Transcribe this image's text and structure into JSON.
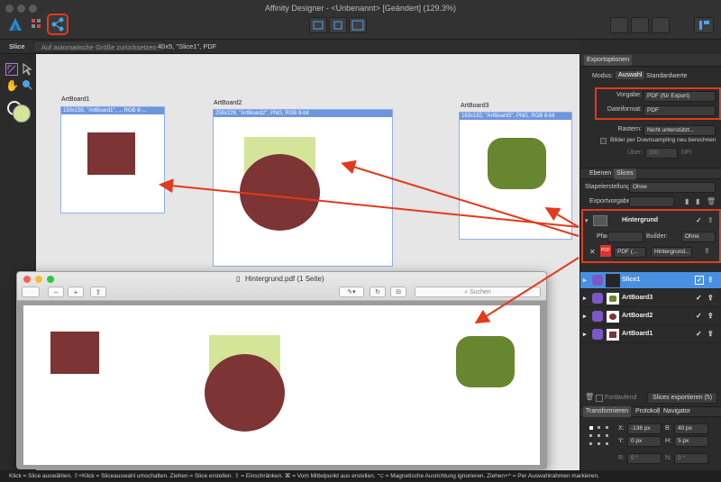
{
  "window": {
    "title": "Affinity Designer - <Unbenannt> [Geändert] (129.3%)"
  },
  "context": {
    "tool": "Slice",
    "reset_label": "Auf automatische Größe zurücksetzen",
    "info": "40x5, \"Slice1\", PDF"
  },
  "artboards": [
    {
      "label": "ArtBoard1",
      "header": "150x155, \"ArtBoard1\", ... RGB 8-..."
    },
    {
      "label": "ArtBoard2",
      "header": "258x226, \"ArtBoard2\", PNG, RGB 8-bit"
    },
    {
      "label": "ArtBoard3",
      "header": "163x182, \"ArtBoard3\", PNG, RGB 8-bit"
    }
  ],
  "export": {
    "title": "Exportoptionen",
    "modus_label": "Modus:",
    "tab_selection": "Auswahl",
    "tab_defaults": "Standardwerte",
    "vorgabe_label": "Vorgabe:",
    "vorgabe_value": "PDF (für Export)",
    "format_label": "Dateiformat:",
    "format_value": "PDF",
    "raster_label": "Rastern:",
    "raster_value": "Nicht unterstützt...",
    "resample_label": "Bilder per Downsampling neu berechnen",
    "dpi_label": "Über:",
    "dpi_value": "300",
    "dpi_unit": "DPI"
  },
  "slices": {
    "tab_layers": "Ebenen",
    "tab_slices": "Slices",
    "batch_label": "Stapelerstellung:",
    "batch_value": "Ohne",
    "preset_label": "Exportvorgabe:",
    "group_name": "Hintergrund",
    "path_label": "Pfad:",
    "builder_label": "Builder:",
    "builder_value": "Ohne",
    "format_value": "PDF (...",
    "name_value": "Hintergrund...",
    "layers": [
      {
        "name": "Slice1"
      },
      {
        "name": "ArtBoard3"
      },
      {
        "name": "ArtBoard2"
      },
      {
        "name": "ArtBoard1"
      }
    ],
    "continuous_label": "Fortlaufend",
    "export_button": "Slices exportieren (5)"
  },
  "transform": {
    "tab_transform": "Transformieren",
    "tab_history": "Protokoll",
    "tab_navigator": "Navigator",
    "x_label": "X:",
    "x_value": "-136 px",
    "y_label": "Y:",
    "y_value": "0 px",
    "b_label": "B:",
    "b_value": "40 px",
    "h_label": "H:",
    "h_value": "5 px",
    "r_label": "R:",
    "r_value": "0 °",
    "n_label": "N:",
    "n_value": "0 °"
  },
  "preview": {
    "title": "Hintergrund.pdf (1 Seite)",
    "search_placeholder": "Suchen"
  },
  "status": "Klick = Slice auswählen. ⇧+Klick = Sliceauswahl umschalten. Ziehen = Slice erstellen. ⇧ = Einschränken. ⌘ = Vom Mittelpunkt aus erstellen. ⌥ = Magnetische Ausrichtung ignorieren. Ziehen+^ = Per Auswahlrahmen markieren.",
  "colors": {
    "darkred": "#7c3434",
    "lightgreen": "#d4e59a",
    "olive": "#67862f",
    "accent": "#4a90e2",
    "highlight": "#e23a1c"
  }
}
